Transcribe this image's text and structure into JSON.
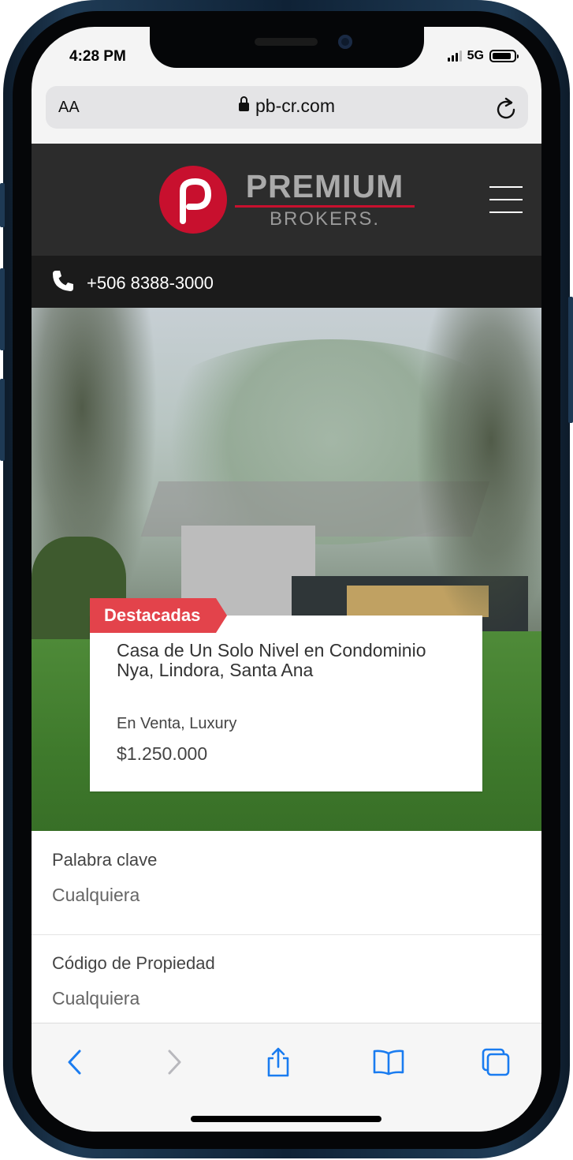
{
  "status_bar": {
    "time": "4:28 PM",
    "network": "5G",
    "battery_level": 0.9
  },
  "browser": {
    "text_size_label": "AA",
    "url": "pb-cr.com"
  },
  "site": {
    "logo": {
      "brand_top": "PREMIUM",
      "brand_bottom": "BROKERS."
    },
    "phone": "+506 8388-3000"
  },
  "featured": {
    "badge": "Destacadas",
    "title": "Casa de Un Solo Nivel en Condominio Nya, Lindora, Santa Ana",
    "status": "En Venta, Luxury",
    "price": "$1.250.000"
  },
  "search_fields": [
    {
      "label": "Palabra clave",
      "value": "Cualquiera"
    },
    {
      "label": "Código de Propiedad",
      "value": "Cualquiera"
    }
  ],
  "colors": {
    "accent": "#e3434b",
    "brand_red": "#c8102e",
    "ios_blue": "#1a7cf0",
    "header_bg": "#2c2c2c"
  }
}
